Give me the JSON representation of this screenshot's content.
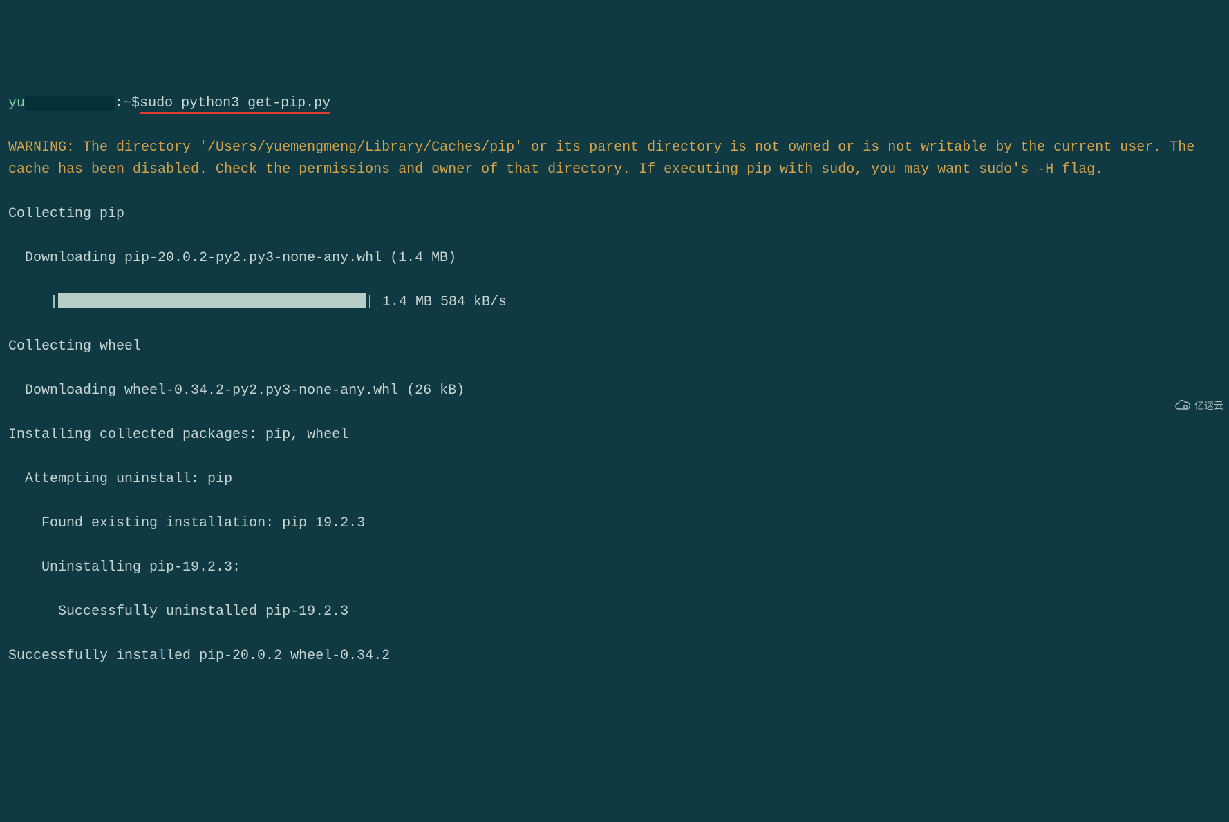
{
  "prompt": {
    "user_prefix": "yu",
    "user_suffix": "",
    "sep": ":",
    "path": "~",
    "dollar": "$",
    "command": "sudo python3 get-pip.py"
  },
  "warning": "WARNING: The directory '/Users/yuemengmeng/Library/Caches/pip' or its parent directory is not owned or is not writable by the current user. The cache has been disabled. Check the permissions and owner of that directory. If executing pip with sudo, you may want sudo's -H flag.",
  "lines": {
    "l1": "Collecting pip",
    "l2": "  Downloading pip-20.0.2-py2.py3-none-any.whl (1.4 MB)",
    "l3_prefix": "     |",
    "l3_suffix": "| 1.4 MB 584 kB/s",
    "l4": "Collecting wheel",
    "l5": "  Downloading wheel-0.34.2-py2.py3-none-any.whl (26 kB)",
    "l6": "Installing collected packages: pip, wheel",
    "l7": "  Attempting uninstall: pip",
    "l8": "    Found existing installation: pip 19.2.3",
    "l9": "    Uninstalling pip-19.2.3:",
    "l10": "      Successfully uninstalled pip-19.2.3",
    "l11": "Successfully installed pip-20.0.2 wheel-0.34.2"
  },
  "watermark": {
    "text": "亿速云"
  }
}
